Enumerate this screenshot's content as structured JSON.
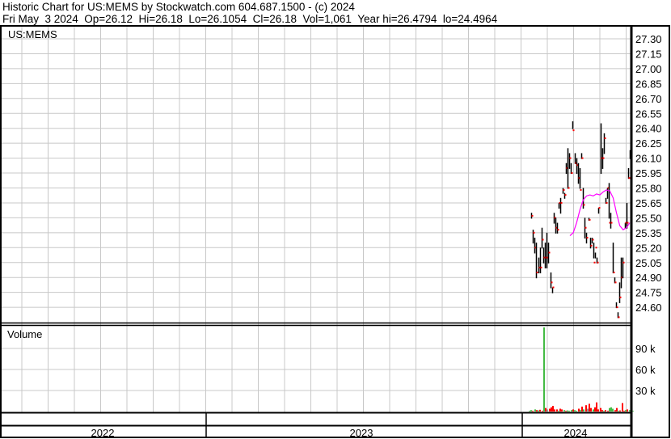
{
  "header": {
    "title": "Historic Chart for US:MEMS by Stockwatch.com 604.687.1500 - (c) 2024",
    "quote": "Fri May  3 2024  Op=26.12  Hi=26.18  Lo=26.1054  Cl=26.18  Vol=1,061  Year hi=26.4794  lo=24.4964"
  },
  "chart_data": [
    {
      "type": "ohlc",
      "title": "US:MEMS",
      "ylim": [
        24.45,
        27.42
      ],
      "yticks": [
        "27.30",
        "27.15",
        "27.00",
        "26.85",
        "26.70",
        "26.55",
        "26.40",
        "26.25",
        "26.10",
        "25.95",
        "25.80",
        "25.65",
        "25.50",
        "25.35",
        "25.20",
        "25.05",
        "24.90",
        "24.75",
        "24.60"
      ],
      "bars": [
        [
          25.55,
          25.5,
          25.52
        ],
        [
          25.38,
          25.25,
          25.35
        ],
        [
          25.3,
          25.15,
          25.2
        ],
        [
          25.25,
          24.9,
          24.95
        ],
        [
          25.1,
          24.95,
          25.0
        ],
        [
          25.2,
          24.95,
          25.0
        ],
        [
          25.4,
          25.2,
          25.28
        ],
        [
          25.2,
          25.05,
          25.1
        ],
        [
          25.25,
          25.0,
          25.1
        ],
        [
          25.35,
          25.0,
          25.1
        ],
        [
          25.25,
          25.05,
          25.15
        ],
        [
          24.95,
          24.8,
          24.85
        ],
        [
          24.8,
          24.75,
          24.8
        ],
        [
          25.55,
          25.45,
          25.5
        ],
        [
          25.5,
          25.35,
          25.4
        ],
        [
          25.45,
          25.35,
          25.38
        ],
        [
          25.65,
          25.6,
          25.65
        ],
        [
          25.7,
          25.55,
          25.65
        ],
        [
          25.8,
          25.75,
          25.78
        ],
        [
          25.75,
          25.7,
          25.73
        ],
        [
          26.05,
          25.95,
          26.0
        ],
        [
          26.2,
          25.8,
          25.8
        ],
        [
          26.15,
          26.0,
          26.1
        ],
        [
          26.05,
          25.95,
          25.95
        ],
        [
          26.47,
          26.4,
          26.38
        ],
        [
          26.15,
          26.05,
          26.05
        ],
        [
          26.1,
          25.95,
          26.03
        ],
        [
          26.05,
          25.85,
          25.9
        ],
        [
          26.0,
          25.8,
          25.78
        ],
        [
          26.15,
          26.1,
          26.1
        ],
        [
          25.8,
          25.6,
          25.63
        ],
        [
          25.5,
          25.3,
          25.4
        ],
        [
          25.35,
          25.25,
          25.3
        ],
        [
          25.5,
          25.48,
          25.48
        ],
        [
          25.3,
          25.2,
          25.22
        ],
        [
          25.3,
          25.25,
          25.28
        ],
        [
          25.25,
          25.1,
          25.05
        ],
        [
          25.15,
          25.1,
          25.2
        ],
        [
          25.1,
          25.05,
          25.05
        ],
        [
          25.6,
          25.55,
          25.6
        ],
        [
          26.45,
          25.95,
          26.1
        ],
        [
          26.2,
          26.0,
          26.1
        ],
        [
          26.35,
          26.15,
          26.3
        ],
        [
          25.7,
          25.65,
          25.65
        ],
        [
          25.8,
          25.7,
          25.8
        ],
        [
          25.85,
          25.5,
          25.45
        ],
        [
          25.55,
          25.4,
          25.45
        ],
        [
          25.25,
          24.95,
          24.95
        ],
        [
          24.9,
          24.85,
          24.85
        ],
        [
          24.65,
          24.6,
          24.6
        ],
        [
          24.55,
          24.5,
          24.5
        ],
        [
          24.85,
          24.65,
          24.7
        ],
        [
          25.1,
          24.8,
          24.9
        ],
        [
          25.1,
          24.9,
          25.05
        ],
        [
          25.45,
          25.4,
          25.45
        ],
        [
          25.65,
          25.4,
          25.45
        ],
        [
          26.0,
          25.9,
          25.9
        ],
        [
          26.18,
          26.1,
          26.18
        ]
      ],
      "moving_average": [
        25.32,
        25.35,
        25.45,
        25.58,
        25.68,
        25.72,
        25.73,
        25.72,
        25.74,
        25.73,
        25.76,
        25.78,
        25.77,
        25.7,
        25.55,
        25.42,
        25.38,
        25.4,
        25.45
      ],
      "colors": {
        "bar": "#000000",
        "close": "#ff0000",
        "ma": "#ff00ff"
      }
    },
    {
      "type": "bar",
      "title": "Volume",
      "ylim": [
        0,
        125000
      ],
      "yticks": [
        "90 k",
        "60 k",
        "30 k"
      ],
      "ytick_values": [
        90000,
        60000,
        30000
      ],
      "values": [
        1000,
        2000,
        1000,
        3000,
        2000,
        1500,
        2500,
        1000,
        120000,
        5000,
        3000,
        4000,
        6000,
        8000,
        3000,
        3000,
        1000,
        4000,
        3000,
        2000,
        1000,
        1500,
        1000,
        2000,
        3000,
        2000,
        1000,
        4000,
        2000,
        7000,
        3000,
        9000,
        4000,
        11000,
        5000,
        3000,
        6000,
        13000,
        3000,
        5000,
        2000,
        1000,
        2000,
        1000,
        5000,
        6000,
        4000,
        2000,
        5000,
        1000,
        1500,
        12000,
        1000,
        2000,
        3000,
        2000,
        4000,
        1000
      ],
      "colors": [
        "g",
        "g",
        "r",
        "g",
        "r",
        "g",
        "r",
        "r",
        "g",
        "r",
        "gr",
        "r",
        "r",
        "r",
        "r",
        "r",
        "g",
        "r",
        "r",
        "g",
        "r",
        "g",
        "g",
        "g",
        "r",
        "g",
        "g",
        "r",
        "g",
        "r",
        "g",
        "r",
        "gr",
        "r",
        "r",
        "g",
        "r",
        "r",
        "r",
        "r",
        "r",
        "g",
        "r",
        "r",
        "g",
        "g",
        "g",
        "r",
        "r",
        "g",
        "r",
        "r",
        "r",
        "g",
        "r",
        "g",
        "g",
        "g"
      ]
    },
    {
      "type": "axis",
      "years": [
        "2022",
        "2023",
        "2024"
      ]
    }
  ]
}
